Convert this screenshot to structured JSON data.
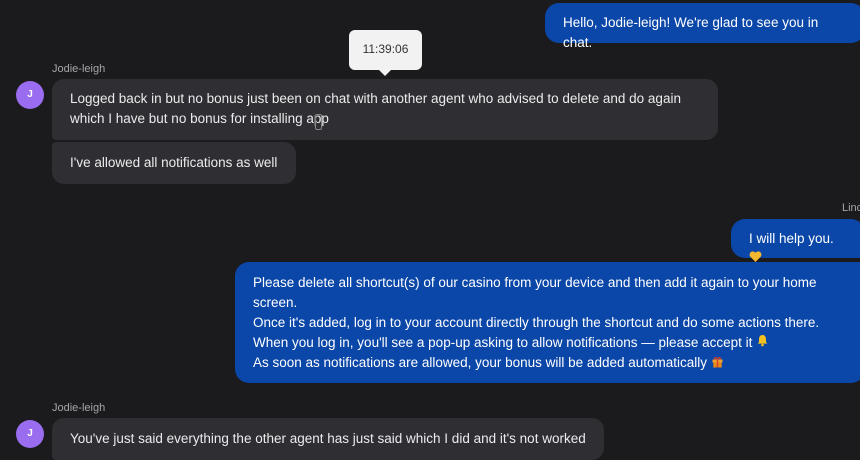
{
  "messages": {
    "m1": {
      "text": "Hello, Jodie-leigh! We're glad to see you in chat."
    },
    "m2": {
      "sender": "Jodie-leigh",
      "avatar": "J",
      "lines": [
        "Logged back in but no bonus just been on chat with another agent who advised to delete and do again",
        "which I have but no bonus for installing app"
      ]
    },
    "m3": {
      "text": "I've allowed all notifications as well"
    },
    "agent_label": "Linc",
    "m4": {
      "text": "I will help you."
    },
    "m5": {
      "lines": [
        "Please delete all shortcut(s) of our casino from your device and then add it again to your home",
        "screen.",
        "Once it's added, log in to your account directly through the shortcut and do some actions there.",
        "When you log in, you'll see a pop-up asking to allow notifications — please accept it",
        "As soon as notifications are allowed, your bonus will be added automatically"
      ]
    },
    "m6": {
      "sender": "Jodie-leigh",
      "avatar": "J",
      "text": "You've just said everything the other agent has just said which I did and it's not worked"
    }
  },
  "tooltip": {
    "time": "11:39:06"
  },
  "icons": {
    "heart": "yellow-heart-icon",
    "bell": "bell-icon",
    "gift": "gift-icon"
  },
  "colors": {
    "background": "#1b1b1d",
    "incoming_bubble": "#2e2e33",
    "outgoing_bubble": "#0b47a8",
    "avatar": "#9a6cf0"
  }
}
